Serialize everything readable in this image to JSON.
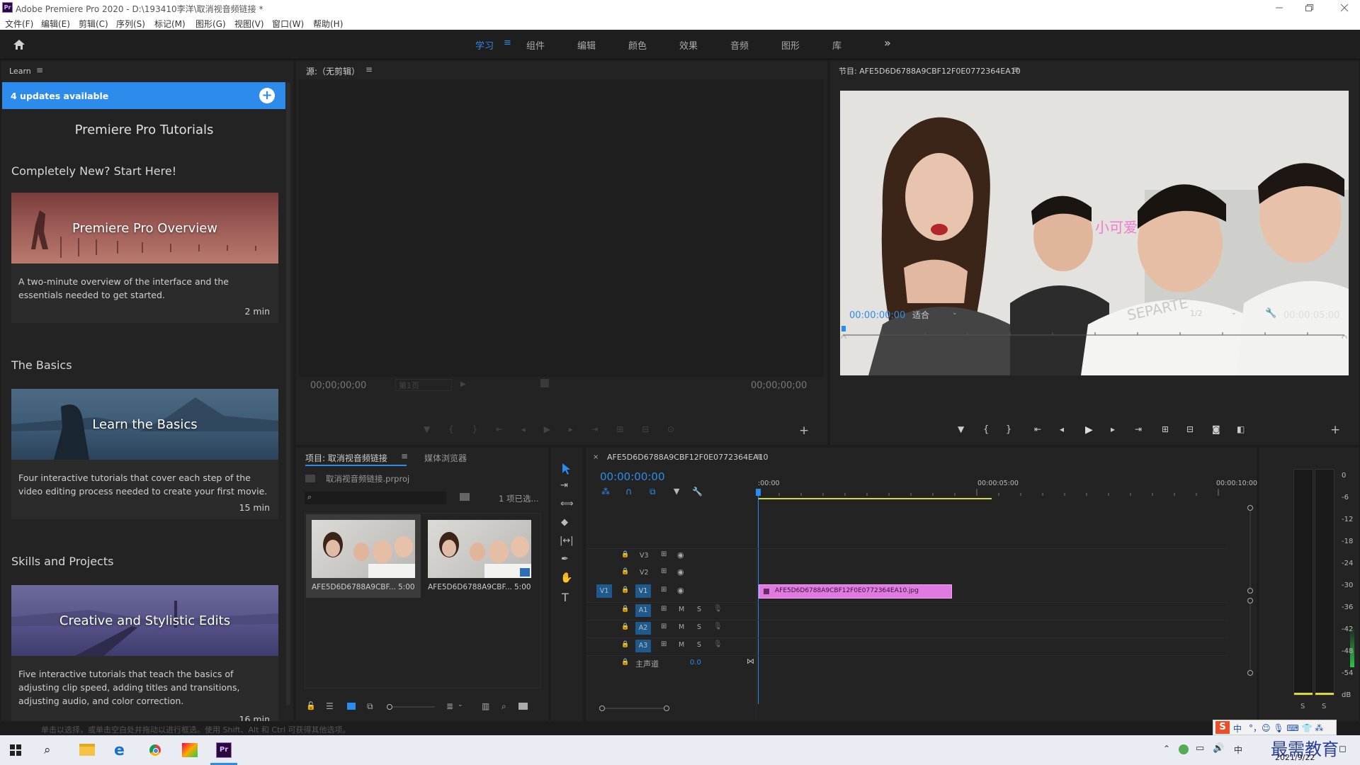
{
  "window": {
    "app_icon_text": "Pr",
    "title": "Adobe Premiere Pro 2020 - D:\\193410李洋\\取消视音频链接 *"
  },
  "menu": [
    "文件(F)",
    "编辑(E)",
    "剪辑(C)",
    "序列(S)",
    "标记(M)",
    "图形(G)",
    "视图(V)",
    "窗口(W)",
    "帮助(H)"
  ],
  "workspaces": {
    "tabs": [
      "学习",
      "组件",
      "编辑",
      "颜色",
      "效果",
      "音频",
      "图形",
      "库"
    ],
    "active": "学习",
    "overflow": "»"
  },
  "learn": {
    "panel_title": "Learn",
    "updates": "4 updates available",
    "heading": "Premiere Pro Tutorials",
    "sections": [
      {
        "title": "Completely New? Start Here!",
        "card_title": "Premiere Pro Overview",
        "desc": "A two-minute overview of the interface and the essentials needed to get started.",
        "time": "2 min"
      },
      {
        "title": "The Basics",
        "card_title": "Learn the Basics",
        "desc": "Four interactive tutorials that cover each step of the video editing process needed to create your first movie.",
        "time": "15 min"
      },
      {
        "title": "Skills and Projects",
        "card_title": "Creative and Stylistic Edits",
        "desc": "Five interactive tutorials that teach the basics of adjusting clip speed, adding titles and transitions, adjusting audio, and color correction.",
        "time": "16 min"
      }
    ]
  },
  "source_monitor": {
    "title": "源:（无剪辑）",
    "timecode_left": "00;00;00;00",
    "page": "第1页",
    "timecode_right": "00;00;00;00"
  },
  "program_monitor": {
    "title": "节目: AFE5D6D6788A9CBF12F0E0772364EA10",
    "timecode": "00:00:00:00",
    "fit": "适合",
    "resolution": "1/2",
    "duration": "00:00:05:00",
    "overlay_sticker": "小可爱"
  },
  "project": {
    "tabs": [
      "项目: 取消视音频链接",
      "媒体浏览器"
    ],
    "file": "取消视音频链接.prproj",
    "search_placeholder": "",
    "selection": "1 项已选...",
    "items": [
      {
        "name": "AFE5D6D6788A9CBF...",
        "duration": "5:00"
      },
      {
        "name": "AFE5D6D6788A9CBF...",
        "duration": "5:00"
      }
    ]
  },
  "timeline": {
    "sequence": "AFE5D6D6788A9CBF12F0E0772364EA10",
    "timecode": "00:00:00:00",
    "ruler": [
      ":00:00",
      "00:00:05:00",
      "00:00:10:00"
    ],
    "video_tracks": [
      "V3",
      "V2",
      "V1"
    ],
    "audio_tracks": [
      "A1",
      "A2",
      "A3"
    ],
    "source_patch": "V1",
    "mute_label": "M",
    "solo_label": "S",
    "master_label": "主声道",
    "master_value": "0.0",
    "clip_name": "AFE5D6D6788A9CBF12F0E0772364EA10.jpg"
  },
  "meter": {
    "scale": [
      "0",
      "-6",
      "-12",
      "-18",
      "-24",
      "-30",
      "-36",
      "-42",
      "-48",
      "-54",
      "dB"
    ],
    "solo_buttons": [
      "S",
      "S"
    ]
  },
  "status": {
    "hint": "单击以选择，或单击空白处并拖动以进行框选。使用 Shift、Alt 和 Ctrl 可获得其他选项。"
  },
  "tray": {
    "ime": "中",
    "watermark": "最需教育",
    "date": "2021/9/22"
  },
  "colors": {
    "accent": "#2d8ceb",
    "timecode": "#2d8ceb",
    "clip": "#e07ae0",
    "track_target": "#1e5a8c",
    "work_area": "#d8d83a"
  }
}
